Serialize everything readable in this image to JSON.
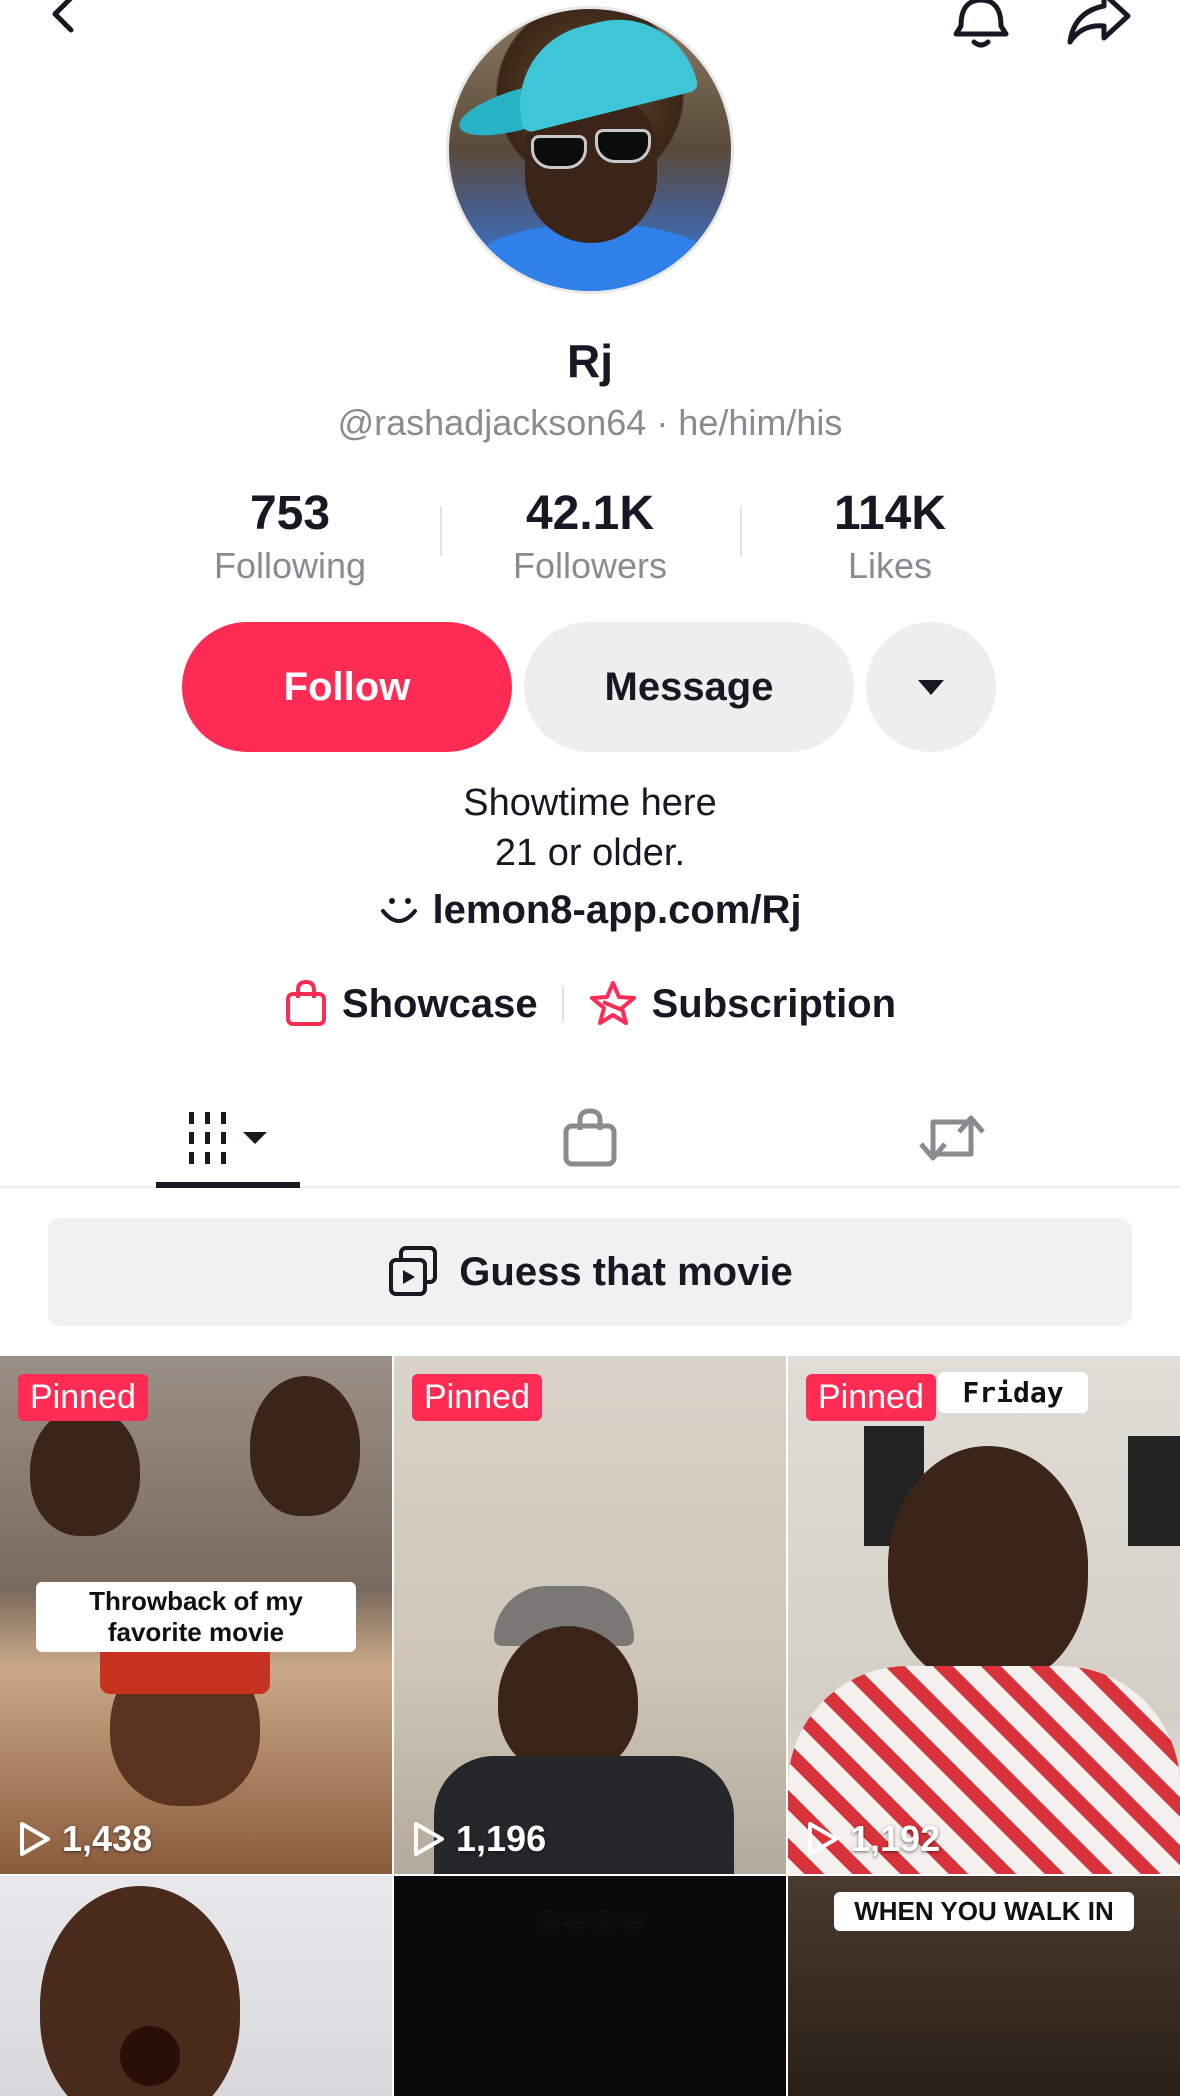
{
  "profile": {
    "name": "Rj",
    "handle_line": "@rashadjackson64 · he/him/his"
  },
  "stats": [
    {
      "value": "753",
      "label": "Following"
    },
    {
      "value": "42.1K",
      "label": "Followers"
    },
    {
      "value": "114K",
      "label": "Likes"
    }
  ],
  "actions": {
    "follow_label": "Follow",
    "message_label": "Message"
  },
  "bio": {
    "line1": "Showtime here",
    "line2": "21 or older.",
    "link": "lemon8-app.com/Rj"
  },
  "shop_row": {
    "showcase": "Showcase",
    "subscription": "Subscription"
  },
  "playlist": {
    "label": "Guess that movie"
  },
  "videos": [
    {
      "badge": "Pinned",
      "views": "1,438",
      "caption": "Throwback of my favorite movie"
    },
    {
      "badge": "Pinned",
      "views": "1,196"
    },
    {
      "badge": "Pinned",
      "views": "1,192",
      "caption": "Friday"
    },
    {},
    {
      "caption": "😂😂😂😂"
    },
    {
      "caption": "WHEN YOU WALK IN"
    }
  ],
  "colors": {
    "accent": "#fe2c55",
    "secondary_button": "#eeeeef",
    "muted_text": "#8a8b91"
  },
  "icons": {
    "back": "chevron-left-icon",
    "bell": "bell-icon",
    "share": "share-arrow-icon",
    "link": "lemon8-smile-icon",
    "showcase": "shopping-bag-icon",
    "subscription": "star-badge-icon",
    "videos_tab": "grid-icon",
    "shop_tab": "shopping-bag-icon",
    "repost_tab": "repost-icon",
    "playlist": "playlist-icon",
    "views": "play-icon"
  }
}
